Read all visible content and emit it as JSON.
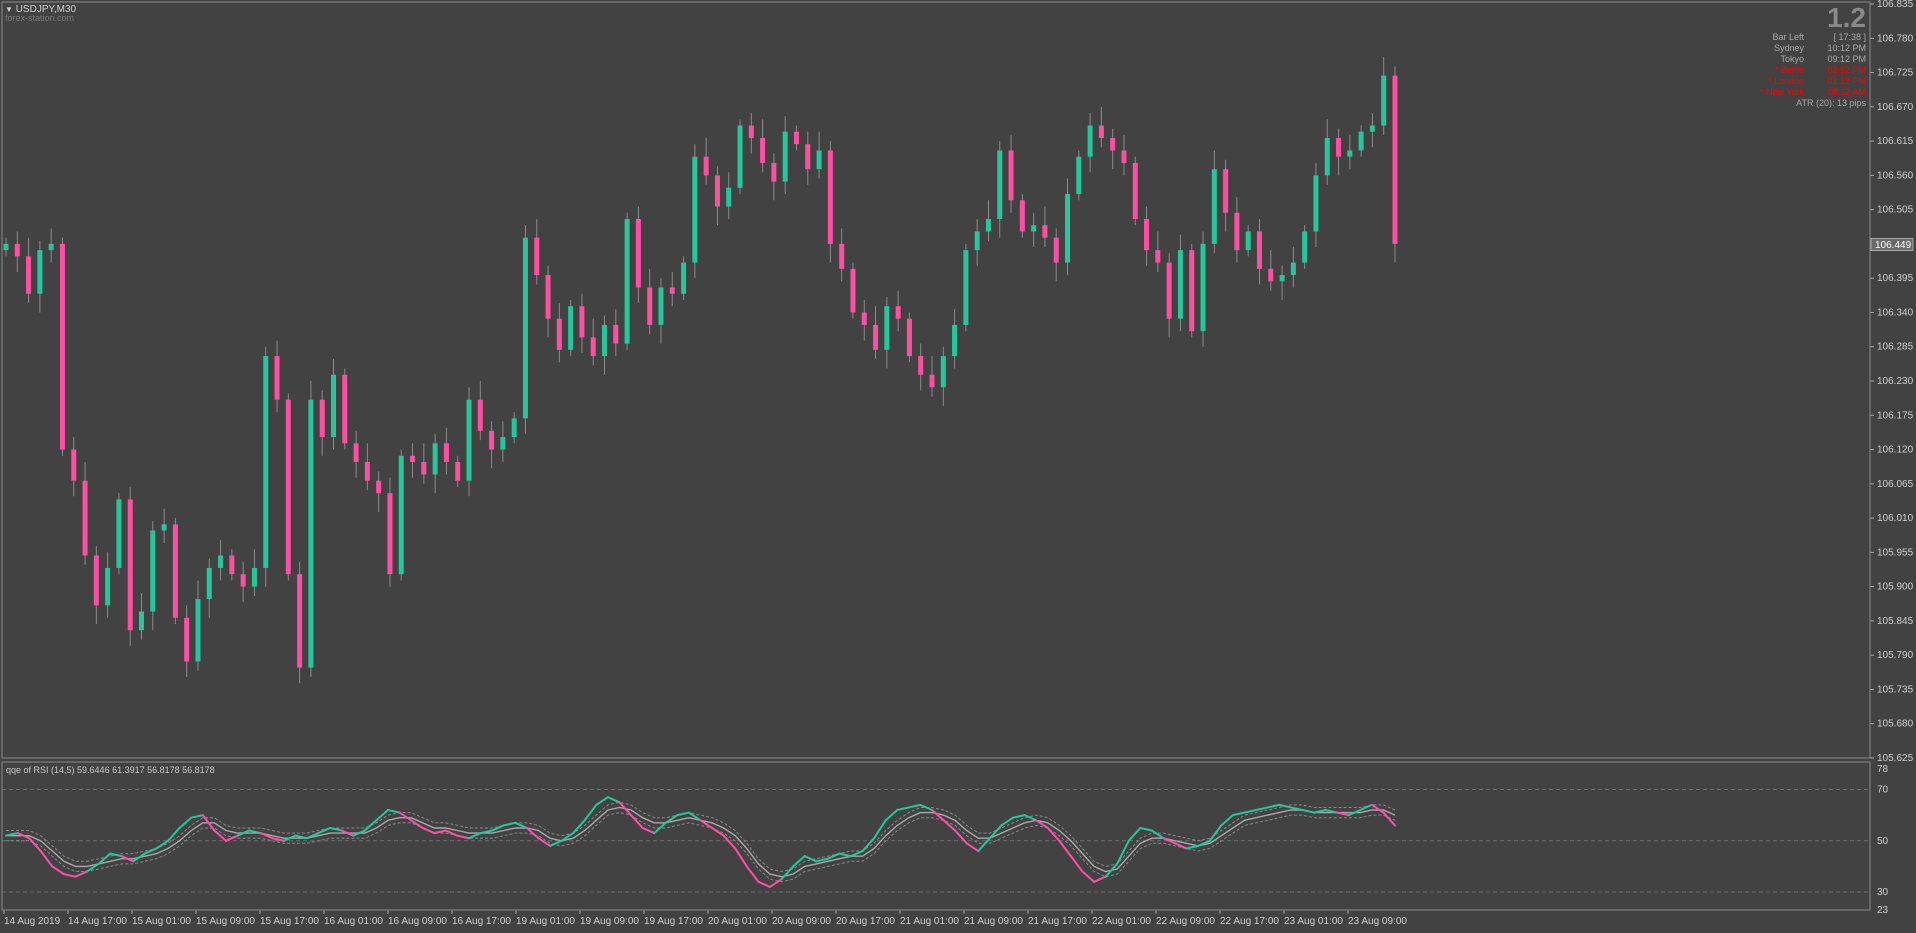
{
  "header": {
    "symbol_label": "USDJPY,M30",
    "watermark": "forex-station.com",
    "menu_icon": "triangle-down-icon"
  },
  "info_panel": {
    "big_number": "1.2",
    "rows": [
      {
        "label": "Bar Left",
        "value": "[ 17:38 ]",
        "color": "#a9a9a9"
      },
      {
        "label": "Sydney",
        "value": "10:12 PM",
        "color": "#a9a9a9"
      },
      {
        "label": "Tokyo",
        "value": "09:12 PM",
        "color": "#a9a9a9"
      },
      {
        "label": "* Berlin",
        "value": "02:12 PM",
        "color": "#ff0000"
      },
      {
        "label": "* London",
        "value": "01:12 PM",
        "color": "#ff0000"
      },
      {
        "label": "* New York",
        "value": "08:12 AM",
        "color": "#ff0000"
      }
    ],
    "atr": "ATR (20): 13 pips"
  },
  "indicator": {
    "label": "qqe of RSI (14,5) 59.6446 61.3917 56.8178 56.8178"
  },
  "colors": {
    "background": "#424242",
    "bull": "#26c79a",
    "bear": "#ff4fa3",
    "grid": "#5a5a5a",
    "axis_text": "#d0d0d0"
  },
  "chart_data": [
    {
      "type": "candlestick",
      "symbol": "USDJPY",
      "timeframe": "M30",
      "ylim": [
        105.625,
        106.835
      ],
      "y_ticks": [
        "106.835",
        "106.780",
        "106.725",
        "106.670",
        "106.615",
        "106.560",
        "106.505",
        "106.450",
        "106.395",
        "106.340",
        "106.285",
        "106.230",
        "106.175",
        "106.120",
        "106.065",
        "106.010",
        "105.955",
        "105.900",
        "105.845",
        "105.790",
        "105.735",
        "105.680",
        "105.625"
      ],
      "current_price": "106.449",
      "x_ticks": [
        "14 Aug 2019",
        "14 Aug 17:00",
        "15 Aug 01:00",
        "15 Aug 09:00",
        "15 Aug 17:00",
        "16 Aug 01:00",
        "16 Aug 09:00",
        "16 Aug 17:00",
        "19 Aug 01:00",
        "19 Aug 09:00",
        "19 Aug 17:00",
        "20 Aug 01:00",
        "20 Aug 09:00",
        "20 Aug 17:00",
        "21 Aug 01:00",
        "21 Aug 09:00",
        "21 Aug 17:00",
        "22 Aug 01:00",
        "22 Aug 09:00",
        "22 Aug 17:00",
        "23 Aug 01:00",
        "23 Aug 09:00"
      ],
      "close_path": [
        106.45,
        106.43,
        106.37,
        106.44,
        106.45,
        106.12,
        106.07,
        105.95,
        105.87,
        105.93,
        106.04,
        105.83,
        105.86,
        105.99,
        106.0,
        105.85,
        105.78,
        105.88,
        105.93,
        105.95,
        105.92,
        105.9,
        105.93,
        106.27,
        106.2,
        105.92,
        105.77,
        106.2,
        106.14,
        106.24,
        106.13,
        106.1,
        106.07,
        106.05,
        105.92,
        106.11,
        106.1,
        106.08,
        106.13,
        106.1,
        106.07,
        106.2,
        106.15,
        106.12,
        106.14,
        106.17,
        106.46,
        106.4,
        106.33,
        106.28,
        106.35,
        106.3,
        106.27,
        106.32,
        106.29,
        106.49,
        106.38,
        106.32,
        106.38,
        106.37,
        106.42,
        106.59,
        106.56,
        106.51,
        106.54,
        106.64,
        106.62,
        106.58,
        106.55,
        106.63,
        106.61,
        106.57,
        106.6,
        106.45,
        106.41,
        106.34,
        106.32,
        106.28,
        106.35,
        106.33,
        106.27,
        106.24,
        106.22,
        106.27,
        106.32,
        106.44,
        106.47,
        106.49,
        106.6,
        106.52,
        106.47,
        106.48,
        106.46,
        106.42,
        106.53,
        106.59,
        106.64,
        106.62,
        106.6,
        106.58,
        106.49,
        106.44,
        106.42,
        106.33,
        106.44,
        106.31,
        106.45,
        106.57,
        106.5,
        106.44,
        106.47,
        106.41,
        106.39,
        106.4,
        106.42,
        106.47,
        106.56,
        106.62,
        106.59,
        106.6,
        106.63,
        106.64,
        106.72,
        106.45
      ]
    },
    {
      "type": "line",
      "name": "qqe of RSI (14,5)",
      "ylim": [
        23,
        78
      ],
      "y_ticks": [
        "78",
        "70",
        "50",
        "30",
        "23"
      ],
      "levels": [
        70,
        50,
        30
      ],
      "values_shown": [
        59.6446,
        61.3917,
        56.8178,
        56.8178
      ],
      "rsi_path": [
        52,
        53,
        51,
        46,
        40,
        37,
        36,
        38,
        41,
        45,
        44,
        42,
        45,
        47,
        50,
        55,
        59,
        60,
        54,
        50,
        52,
        54,
        53,
        51,
        50,
        52,
        51,
        53,
        55,
        54,
        52,
        54,
        58,
        62,
        61,
        58,
        55,
        53,
        54,
        52,
        51,
        53,
        54,
        56,
        57,
        55,
        51,
        48,
        50,
        53,
        58,
        64,
        67,
        65,
        60,
        55,
        53,
        57,
        60,
        61,
        58,
        55,
        52,
        47,
        40,
        34,
        32,
        35,
        40,
        44,
        42,
        43,
        45,
        44,
        46,
        51,
        58,
        62,
        63,
        64,
        62,
        58,
        54,
        49,
        46,
        51,
        56,
        59,
        60,
        58,
        55,
        50,
        44,
        38,
        34,
        36,
        41,
        50,
        55,
        54,
        51,
        49,
        47,
        48,
        50,
        56,
        60,
        61,
        62,
        63,
        64,
        63,
        62,
        61,
        62,
        61,
        60,
        62,
        64,
        61,
        56
      ],
      "signal_path": [
        52,
        52,
        52,
        50,
        46,
        42,
        40,
        40,
        41,
        42,
        43,
        43,
        44,
        45,
        47,
        50,
        54,
        57,
        57,
        54,
        53,
        53,
        53,
        52,
        51,
        51,
        51,
        52,
        53,
        53,
        53,
        53,
        55,
        58,
        59,
        59,
        57,
        55,
        55,
        54,
        53,
        53,
        53,
        54,
        55,
        55,
        54,
        51,
        50,
        51,
        54,
        58,
        62,
        63,
        62,
        59,
        57,
        57,
        58,
        59,
        58,
        57,
        55,
        52,
        47,
        41,
        37,
        36,
        37,
        40,
        41,
        42,
        43,
        44,
        44,
        47,
        52,
        56,
        59,
        61,
        61,
        60,
        58,
        54,
        51,
        51,
        53,
        55,
        57,
        58,
        57,
        54,
        50,
        45,
        40,
        38,
        39,
        44,
        49,
        51,
        51,
        50,
        49,
        48,
        49,
        52,
        55,
        58,
        59,
        60,
        61,
        62,
        62,
        61,
        61,
        61,
        61,
        61,
        62,
        62,
        60
      ]
    }
  ]
}
